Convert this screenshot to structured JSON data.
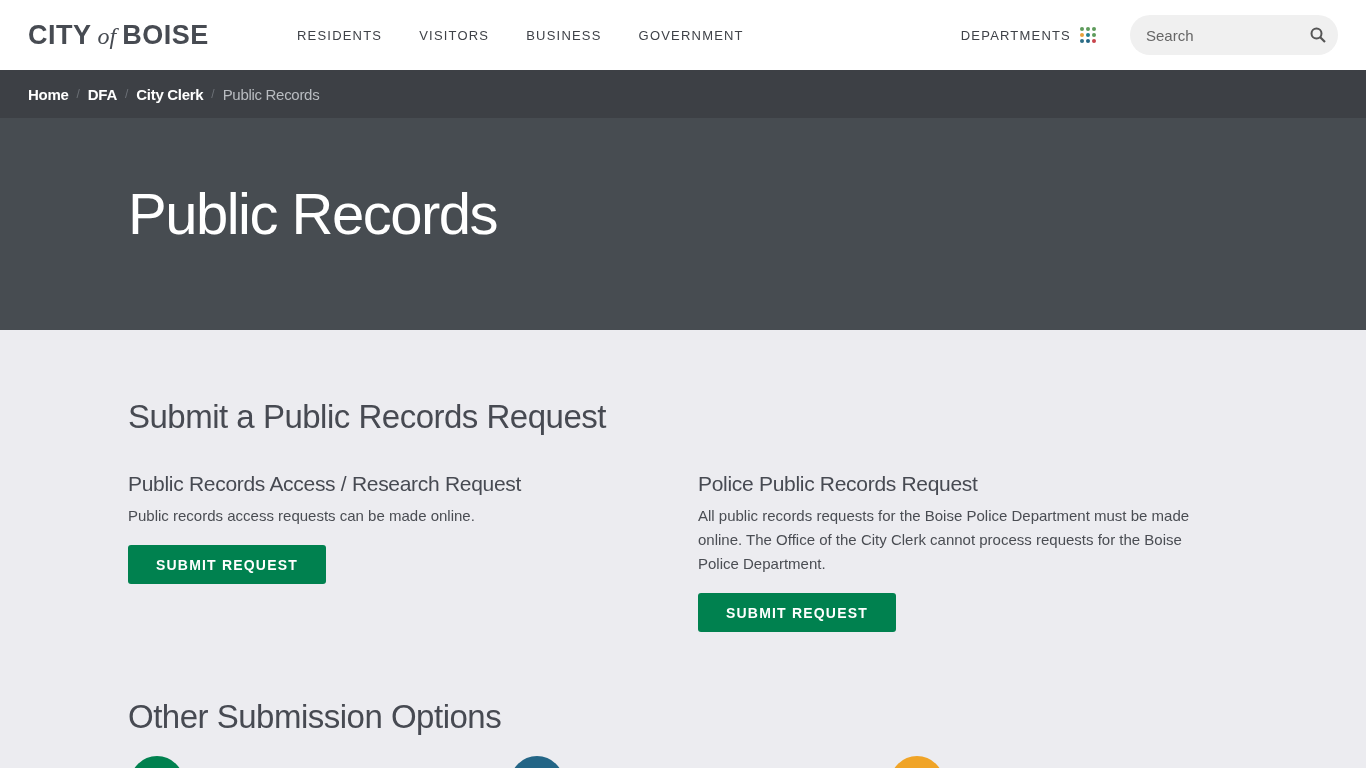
{
  "logo": {
    "first": "CITY",
    "middle": "of",
    "last": "BOISE"
  },
  "nav": [
    "RESIDENTS",
    "VISITORS",
    "BUSINESS",
    "GOVERNMENT"
  ],
  "departments": {
    "label": "DEPARTMENTS"
  },
  "search": {
    "placeholder": "Search"
  },
  "breadcrumb_separator": "/",
  "breadcrumb": [
    {
      "label": "Home",
      "current": false
    },
    {
      "label": "DFA",
      "current": false
    },
    {
      "label": "City Clerk",
      "current": false
    },
    {
      "label": "Public Records",
      "current": true
    }
  ],
  "hero": {
    "title": "Public Records"
  },
  "section": {
    "title": "Submit a Public Records Request"
  },
  "requests": [
    {
      "title": "Public Records Access / Research Request",
      "text": "Public records access requests can be made online.",
      "button": "SUBMIT REQUEST"
    },
    {
      "title": "Police Public Records Request",
      "text": "All public records requests for the Boise Police Department must be made online. The Office of the City Clerk cannot process requests for the Boise Police Department.",
      "button": "SUBMIT REQUEST"
    }
  ],
  "other": {
    "title": "Other Submission Options",
    "options": [
      {
        "color": "#00814f"
      },
      {
        "color": "#236586"
      },
      {
        "color": "#f0a427"
      }
    ]
  }
}
